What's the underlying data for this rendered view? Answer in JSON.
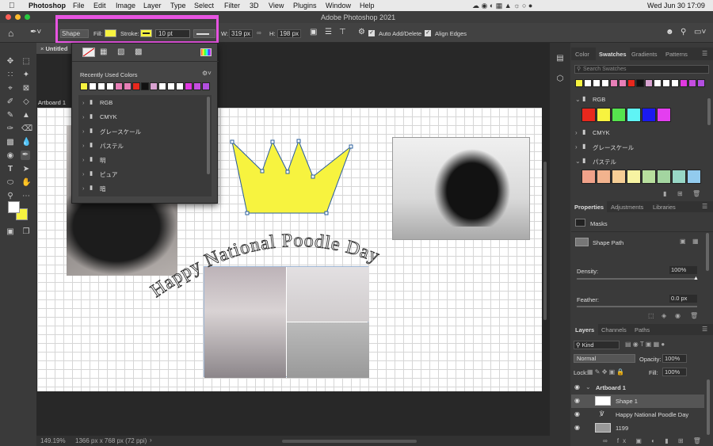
{
  "menubar": {
    "app": "Photoshop",
    "items": [
      "File",
      "Edit",
      "Image",
      "Layer",
      "Type",
      "Select",
      "Filter",
      "3D",
      "View",
      "Plugins",
      "Window",
      "Help"
    ],
    "clock": "Wed Jun 30  17:09"
  },
  "window_title": "Adobe Photoshop 2021",
  "options": {
    "tool_mode": "Shape",
    "fill_label": "Fill:",
    "stroke_label": "Stroke:",
    "stroke_width": "10 pt",
    "w_label": "W:",
    "w_value": "319 px",
    "h_label": "H:",
    "h_value": "198 px",
    "auto_add_delete": "Auto Add/Delete",
    "align_edges": "Align Edges"
  },
  "doc": {
    "tab": "Untitled",
    "artboard": "Artboard 1",
    "zoom": "149.19%",
    "info": "1366 px x 768 px (72 ppi)",
    "curved_text": "Happy National Poodle Day"
  },
  "swatch_popup": {
    "recently_used": "Recently Used Colors",
    "folders": [
      "RGB",
      "CMYK",
      "グレースケール",
      "パステル",
      "明",
      "ピュア",
      "暗"
    ]
  },
  "color_panel": {
    "tabs": [
      "Color",
      "Swatches",
      "Gradients",
      "Patterns"
    ],
    "search_placeholder": "Search Swatches",
    "folders": [
      "RGB",
      "CMYK",
      "グレースケール",
      "パステル"
    ]
  },
  "properties": {
    "tabs": [
      "Properties",
      "Adjustments",
      "Libraries"
    ],
    "masks": "Masks",
    "shape_path": "Shape Path",
    "density_label": "Density:",
    "density_value": "100%",
    "feather_label": "Feather:",
    "feather_value": "0.0 px"
  },
  "layers": {
    "tabs": [
      "Layers",
      "Channels",
      "Paths"
    ],
    "kind": "Kind",
    "blend": "Normal",
    "opacity_label": "Opacity:",
    "opacity_value": "100%",
    "lock_label": "Lock:",
    "fill_label": "Fill:",
    "fill_value": "100%",
    "items": [
      "Artboard 1",
      "Shape 1",
      "Happy National Poodle Day",
      "1199"
    ]
  },
  "colors": {
    "accent": "#e754e1",
    "fill": "#f7f33f",
    "selection": "#2b5f9e"
  }
}
